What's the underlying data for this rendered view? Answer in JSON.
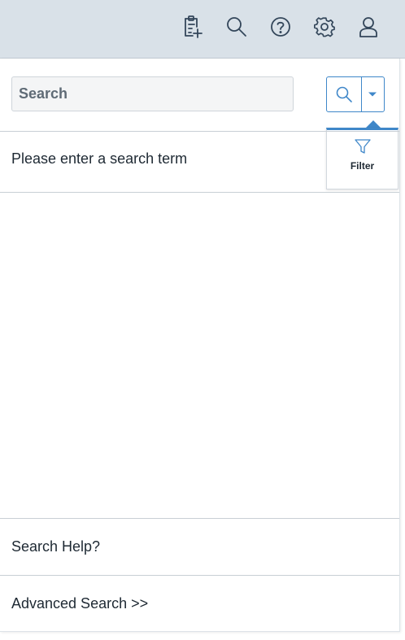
{
  "toolbar": {
    "icons": [
      "new-record-icon",
      "search-icon",
      "help-icon",
      "gear-icon",
      "user-icon"
    ]
  },
  "search": {
    "placeholder": "Search",
    "value": ""
  },
  "filter": {
    "label": "Filter"
  },
  "results": {
    "message": "Please enter a search term"
  },
  "footer": {
    "help_label": "Search Help?",
    "advanced_label": "Advanced Search >>"
  },
  "colors": {
    "accent": "#3f87c9",
    "topbar_bg": "#d9e1e8",
    "text": "#1e2933"
  }
}
